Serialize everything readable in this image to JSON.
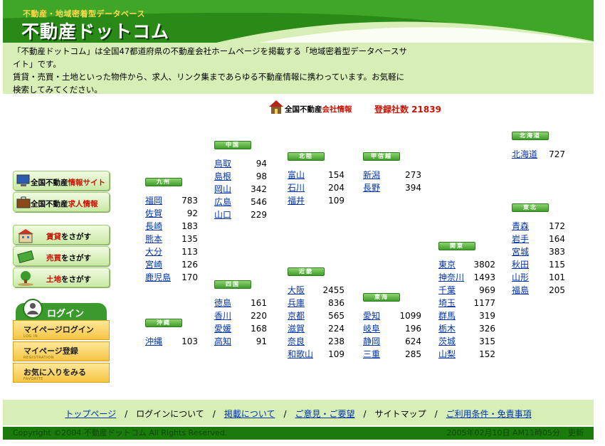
{
  "header": {
    "subtitle": "不動産・地域密着型データベース",
    "title": "不動産ドットコム"
  },
  "intro": {
    "line1": "「不動産ドットコム」は全国47都道府県の不動産会社ホームページを掲載する「地域密着型データベースサイト」です。",
    "line2": "賃貸・売買・土地といった物件から、求人、リンク集まであらゆる不動産情報に携わっています。お気軽に検索してみてください。"
  },
  "badge": {
    "prefix": "全国不動産",
    "highlight": "会社情報",
    "count": "登録社数 21839"
  },
  "menu": {
    "info_site_a": "全国不動産",
    "info_site_b": "情報サイト",
    "jobs_a": "全国不動産",
    "jobs_b": "求人情報",
    "rent_a": "賃貸",
    "rent_b": "をさがす",
    "sale_a": "売買",
    "sale_b": "をさがす",
    "land_a": "土地",
    "land_b": "をさがす"
  },
  "login": {
    "heading": "ログイン",
    "mypage_login": "マイページログイン",
    "mypage_login_sub": "LOG IN",
    "mypage_register": "マイページ登録",
    "mypage_register_sub": "REGISTRATION",
    "favorites": "お気に入りをみる",
    "favorites_sub": "FAVORITE"
  },
  "regions": {
    "kyushu": {
      "name": "九州",
      "prefs": [
        [
          "福岡",
          "783"
        ],
        [
          "佐賀",
          "92"
        ],
        [
          "長崎",
          "183"
        ],
        [
          "熊本",
          "135"
        ],
        [
          "大分",
          "113"
        ],
        [
          "宮崎",
          "126"
        ],
        [
          "鹿児島",
          "170"
        ]
      ]
    },
    "okinawa": {
      "name": "沖縄",
      "prefs": [
        [
          "沖縄",
          "103"
        ]
      ]
    },
    "chugoku": {
      "name": "中国",
      "prefs": [
        [
          "鳥取",
          "94"
        ],
        [
          "島根",
          "98"
        ],
        [
          "岡山",
          "342"
        ],
        [
          "広島",
          "546"
        ],
        [
          "山口",
          "229"
        ]
      ]
    },
    "shikoku": {
      "name": "四国",
      "prefs": [
        [
          "徳島",
          "161"
        ],
        [
          "香川",
          "220"
        ],
        [
          "愛媛",
          "168"
        ],
        [
          "高知",
          "91"
        ]
      ]
    },
    "hokuriku": {
      "name": "北陸",
      "prefs": [
        [
          "富山",
          "154"
        ],
        [
          "石川",
          "204"
        ],
        [
          "福井",
          "109"
        ]
      ]
    },
    "kinki": {
      "name": "近畿",
      "prefs": [
        [
          "大阪",
          "2455"
        ],
        [
          "兵庫",
          "836"
        ],
        [
          "京都",
          "565"
        ],
        [
          "滋賀",
          "224"
        ],
        [
          "奈良",
          "238"
        ],
        [
          "和歌山",
          "109"
        ]
      ]
    },
    "koshinetsu": {
      "name": "甲信越",
      "prefs": [
        [
          "新潟",
          "273"
        ],
        [
          "長野",
          "394"
        ]
      ]
    },
    "tokai": {
      "name": "東海",
      "prefs": [
        [
          "愛知",
          "1099"
        ],
        [
          "岐阜",
          "196"
        ],
        [
          "静岡",
          "624"
        ],
        [
          "三重",
          "285"
        ]
      ]
    },
    "kanto": {
      "name": "関東",
      "prefs": [
        [
          "東京",
          "3802"
        ],
        [
          "神奈川",
          "1493"
        ],
        [
          "千葉",
          "969"
        ],
        [
          "埼玉",
          "1177"
        ],
        [
          "群馬",
          "319"
        ],
        [
          "栃木",
          "326"
        ],
        [
          "茨城",
          "315"
        ],
        [
          "山梨",
          "152"
        ]
      ]
    },
    "hokkaido": {
      "name": "北海道",
      "prefs": [
        [
          "北海道",
          "727"
        ]
      ]
    },
    "tohoku": {
      "name": "東北",
      "prefs": [
        [
          "青森",
          "172"
        ],
        [
          "岩手",
          "164"
        ],
        [
          "宮城",
          "383"
        ],
        [
          "秋田",
          "115"
        ],
        [
          "山形",
          "101"
        ],
        [
          "福島",
          "205"
        ]
      ]
    }
  },
  "footer": {
    "top": "トップページ",
    "login_about": "ログインについて",
    "listing_about": "掲載について",
    "feedback": "ご意見・ご要望",
    "sitemap": "サイトマップ",
    "terms": "ご利用条件・免責事項",
    "copyright": "Copyright ©2004 不動産ドットコム All Rights Reserved.",
    "updated": "2005年02月10日 AM11時05分　更新"
  },
  "colors": {
    "header_green": "#2a8a17",
    "light_green": "#d7efb6",
    "link_blue": "#0033aa",
    "accent_red": "#cc1100",
    "login_yellow": "#f5c443"
  }
}
